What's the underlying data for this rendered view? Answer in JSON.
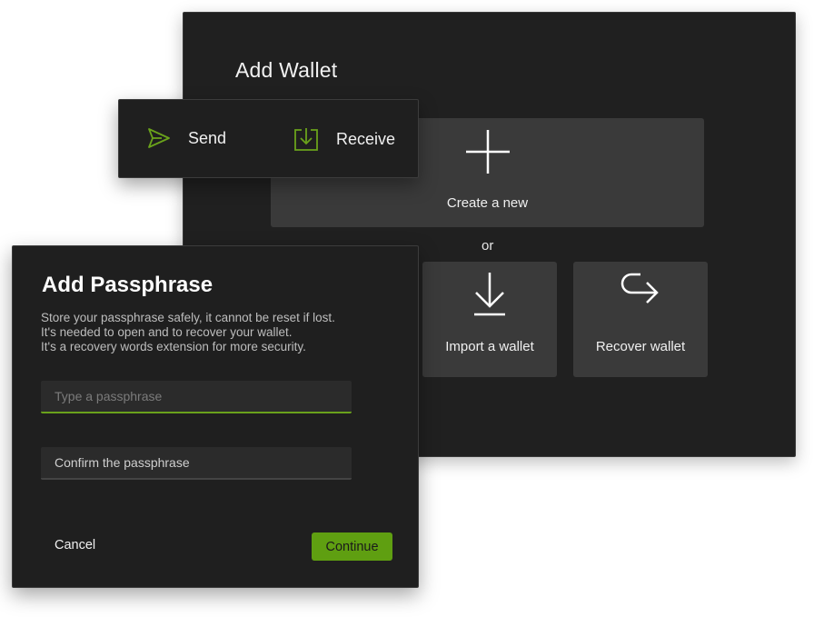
{
  "add_wallet": {
    "title": "Add Wallet",
    "create": {
      "label": "Create a new",
      "icon": "plus-icon"
    },
    "separator": "or",
    "import": {
      "label": "Import a wallet",
      "icon": "download-arrow-icon"
    },
    "recover": {
      "label": "Recover wallet",
      "icon": "return-arrow-icon"
    }
  },
  "actions": {
    "send": {
      "label": "Send",
      "icon": "send-icon"
    },
    "receive": {
      "label": "Receive",
      "icon": "receive-icon"
    },
    "accent_color": "#6aa21b"
  },
  "passphrase_dialog": {
    "title": "Add Passphrase",
    "description_lines": [
      "Store your passphrase safely, it cannot be reset if lost.",
      "It's needed to open and to recover your wallet.",
      "It's a recovery words extension for more security."
    ],
    "passphrase_placeholder": "Type a passphrase",
    "confirm_placeholder": "Confirm the passphrase",
    "cancel_label": "Cancel",
    "continue_label": "Continue",
    "continue_color": "#5f9f11"
  }
}
